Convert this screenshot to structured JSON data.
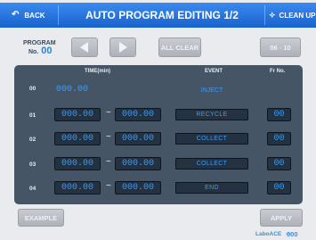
{
  "header": {
    "back_label": "BACK",
    "title": "AUTO PROGRAM EDITING 1/2",
    "cleanup_label": "CLEAN UP"
  },
  "program": {
    "label": "PROGRAM",
    "no_label": "No.",
    "number": "00"
  },
  "controls": {
    "prev_icon": "left-arrow",
    "next_icon": "right-arrow",
    "all_clear_label": "ALL CLEAR",
    "range_label": "06 - 10"
  },
  "table": {
    "headers": {
      "time": "TIME(min)",
      "event": "EVENT",
      "fr": "Fr No."
    },
    "rows": [
      {
        "step": "00",
        "start": "000.00",
        "end": "",
        "event": "INJECT",
        "fr": ""
      },
      {
        "step": "01",
        "start": "000.00",
        "end": "000.00",
        "event": "RECYCLE",
        "fr": "00"
      },
      {
        "step": "02",
        "start": "000.00",
        "end": "000.00",
        "event": "COLLECT",
        "fr": "00"
      },
      {
        "step": "03",
        "start": "000.00",
        "end": "000.00",
        "event": "COLLECT",
        "fr": "00"
      },
      {
        "step": "04",
        "start": "000.00",
        "end": "000.00",
        "event": "END",
        "fr": "00"
      }
    ],
    "separator": "~"
  },
  "footer": {
    "example_label": "EXAMPLE",
    "apply_label": "APPLY",
    "brand": "LaboACE",
    "brand_sep": "---",
    "brand_num": "000"
  },
  "colors": {
    "accent_blue": "#1d6fd9",
    "value_blue": "#3d9cf2",
    "panel": "#455566"
  }
}
